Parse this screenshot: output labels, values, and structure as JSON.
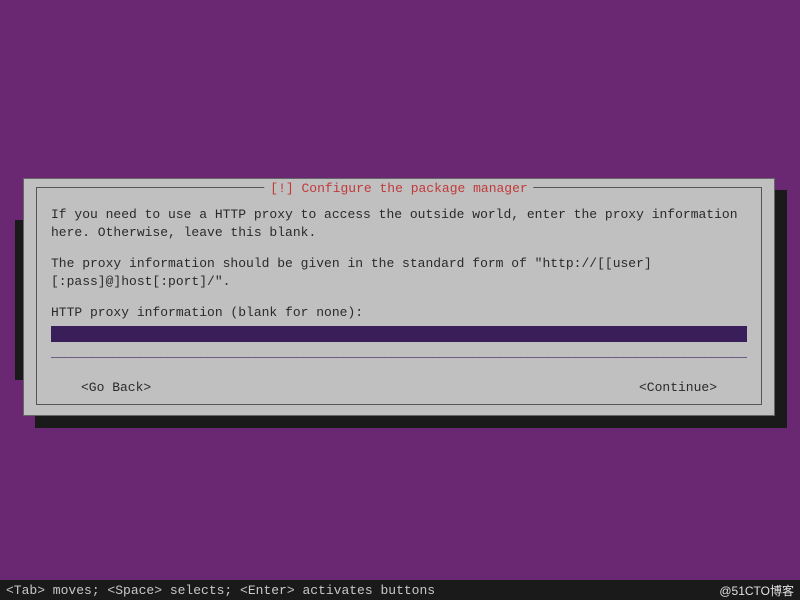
{
  "dialog": {
    "title": "[!] Configure the package manager",
    "paragraph1": "If you need to use a HTTP proxy to access the outside world, enter the proxy information here. Otherwise, leave this blank.",
    "paragraph2": "The proxy information should be given in the standard form of \"http://[[user][:pass]@]host[:port]/\".",
    "prompt": "HTTP proxy information (blank for none):",
    "input_value": "",
    "underline": "_______________________________________________________________________________________________________",
    "go_back": "<Go Back>",
    "continue": "<Continue>"
  },
  "footer": {
    "hint": "<Tab> moves; <Space> selects; <Enter> activates buttons",
    "watermark": "@51CTO博客"
  }
}
